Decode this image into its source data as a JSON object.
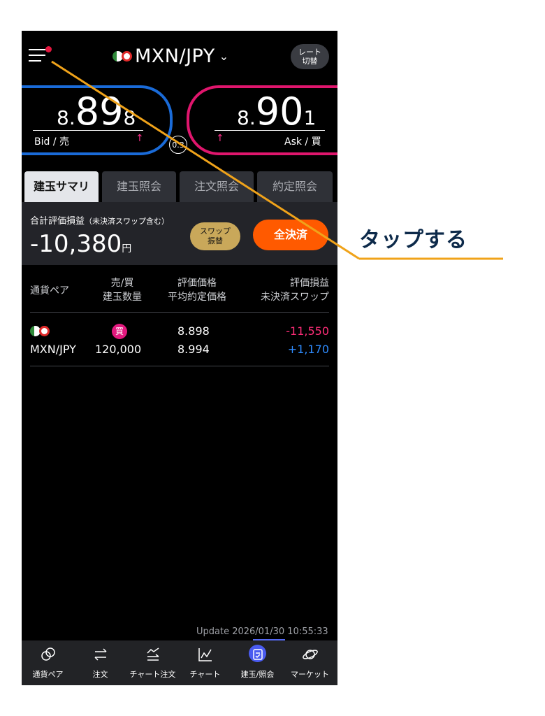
{
  "header": {
    "pair": "MXN/JPY",
    "rate_switch_line1": "レート",
    "rate_switch_line2": "切替"
  },
  "prices": {
    "bid_int": "8.",
    "bid_big": "89",
    "bid_small": "8",
    "bid_label": "Bid / 売",
    "ask_int": "8.",
    "ask_big": "90",
    "ask_small": "1",
    "ask_label": "Ask / 買",
    "spread": "0.3"
  },
  "tabs": [
    "建玉サマリ",
    "建玉照会",
    "注文照会",
    "約定照会"
  ],
  "summary": {
    "label": "合計評価損益",
    "label_note": "（未決済スワップ含む）",
    "value": "-10,380",
    "unit": "円",
    "swap_line1": "スワップ",
    "swap_line2": "振替",
    "close_all": "全決済"
  },
  "table": {
    "headers": {
      "pair": "通貨ペア",
      "side": "売/買",
      "qty": "建玉数量",
      "eval_price": "評価価格",
      "avg_price": "平均約定価格",
      "pnl": "評価損益",
      "swap": "未決済スワップ"
    },
    "rows": [
      {
        "pair": "MXN/JPY",
        "side": "買",
        "qty": "120,000",
        "eval_price": "8.898",
        "avg_price": "8.994",
        "pnl": "-11,550",
        "swap": "+1,170"
      }
    ]
  },
  "update": "Update 2026/01/30 10:55:33",
  "nav": [
    "通貨ペア",
    "注文",
    "チャート注文",
    "チャート",
    "建玉/照会",
    "マーケット"
  ],
  "callout": "タップする",
  "colors": {
    "bid": "#1a6bd8",
    "ask": "#e0166d",
    "close": "#ff5a00",
    "swap": "#c9a85a",
    "loss": "#ff2d78",
    "gain": "#2f8cff",
    "annotation": "#f0a31a"
  }
}
